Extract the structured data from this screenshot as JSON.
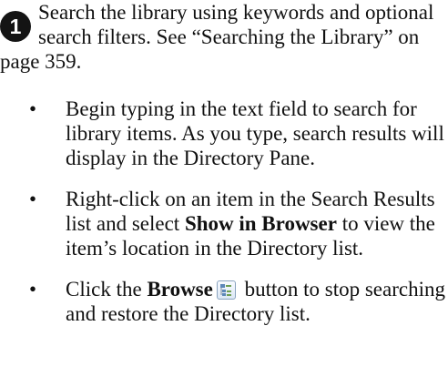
{
  "step": {
    "number": "1",
    "text": "Search the library using keywords and optional search filters. See “Searching the Library” on page 359."
  },
  "bullets": [
    {
      "marker": "•",
      "text": "Begin typing in the text field to search for library items. As you type, search results will display in the Directory Pane."
    },
    {
      "marker": "•",
      "text_before": "Right-click on an item in the Search Results list and select ",
      "bold": "Show in Browser",
      "text_after": " to view the item’s location in the Directory list."
    },
    {
      "marker": "•",
      "text_before": "Click the ",
      "bold": "Browse",
      "icon": "browse-icon",
      "text_after": " button to stop searching and restore the Directory list."
    }
  ]
}
